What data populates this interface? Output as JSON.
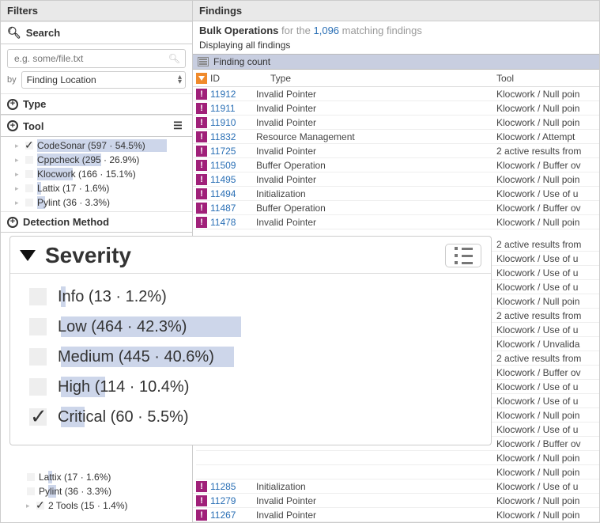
{
  "filters": {
    "title": "Filters",
    "search_label": "Search",
    "search_placeholder": "e.g. some/file.txt",
    "by_label": "by",
    "by_value": "Finding Location",
    "type_label": "Type",
    "tool_label": "Tool",
    "detection_label": "Detection Method",
    "tool_items": [
      {
        "label": "CodeSonar (597 · 54.5%)",
        "pct": 54.5,
        "selected": true
      },
      {
        "label": "Cppcheck (295 · 26.9%)",
        "pct": 26.9,
        "selected": false
      },
      {
        "label": "Klocwork (166 · 15.1%)",
        "pct": 15.1,
        "selected": false
      },
      {
        "label": "Lattix (17 · 1.6%)",
        "pct": 1.6,
        "selected": false
      },
      {
        "label": "Pylint (36 · 3.3%)",
        "pct": 3.3,
        "selected": false
      }
    ],
    "lower_items": [
      {
        "label": "Lattix (17 · 1.6%)",
        "pct": 1.6
      },
      {
        "label": "Pylint (36 · 3.3%)",
        "pct": 3.3
      }
    ],
    "lower_summary": "2 Tools (15 · 1.4%)"
  },
  "findings": {
    "title": "Findings",
    "bulk_strong": "Bulk Operations",
    "bulk_mid": " for the ",
    "bulk_count": "1,096",
    "bulk_tail": " matching findings",
    "displaying": "Displaying all findings",
    "group_label": "Finding count",
    "th_id": "ID",
    "th_type": "Type",
    "th_tool": "Tool",
    "rows": [
      {
        "id": "11912",
        "type": "Invalid Pointer",
        "tool": "Klocwork / Null poin"
      },
      {
        "id": "11911",
        "type": "Invalid Pointer",
        "tool": "Klocwork / Null poin"
      },
      {
        "id": "11910",
        "type": "Invalid Pointer",
        "tool": "Klocwork / Null poin"
      },
      {
        "id": "11832",
        "type": "Resource Management",
        "tool": "Klocwork / Attempt"
      },
      {
        "id": "11725",
        "type": "Invalid Pointer",
        "tool": "2 active results from"
      },
      {
        "id": "11509",
        "type": "Buffer Operation",
        "tool": "Klocwork / Buffer ov"
      },
      {
        "id": "11495",
        "type": "Invalid Pointer",
        "tool": "Klocwork / Null poin"
      },
      {
        "id": "11494",
        "type": "Initialization",
        "tool": "Klocwork / Use of u"
      },
      {
        "id": "11487",
        "type": "Buffer Operation",
        "tool": "Klocwork / Buffer ov"
      },
      {
        "id": "11478",
        "type": "Invalid Pointer",
        "tool": "Klocwork / Null poin"
      }
    ],
    "tail_tools": [
      "2 active results from",
      "Klocwork / Use of u",
      "Klocwork / Use of u",
      "Klocwork / Use of u",
      "Klocwork / Null poin",
      "2 active results from",
      "Klocwork / Use of u",
      "Klocwork / Unvalida",
      "2 active results from",
      "Klocwork / Buffer ov",
      "Klocwork / Use of u",
      "Klocwork / Use of u",
      "Klocwork / Null poin",
      "Klocwork / Use of u",
      "Klocwork / Buffer ov",
      "Klocwork / Null poin",
      "Klocwork / Null poin"
    ],
    "lower_rows": [
      {
        "id": "11285",
        "type": "Initialization",
        "tool": "Klocwork / Use of u"
      },
      {
        "id": "11279",
        "type": "Invalid Pointer",
        "tool": "Klocwork / Null poin"
      },
      {
        "id": "11267",
        "type": "Invalid Pointer",
        "tool": "Klocwork / Null poin"
      }
    ]
  },
  "severity": {
    "title": "Severity",
    "items": [
      {
        "label": "Info (13 · 1.2%)",
        "pct": 1.2,
        "selected": false
      },
      {
        "label": "Low (464 · 42.3%)",
        "pct": 42.3,
        "selected": false
      },
      {
        "label": "Medium (445 · 40.6%)",
        "pct": 40.6,
        "selected": false
      },
      {
        "label": "High (114 · 10.4%)",
        "pct": 10.4,
        "selected": false
      },
      {
        "label": "Critical (60 · 5.5%)",
        "pct": 5.5,
        "selected": true
      }
    ]
  }
}
